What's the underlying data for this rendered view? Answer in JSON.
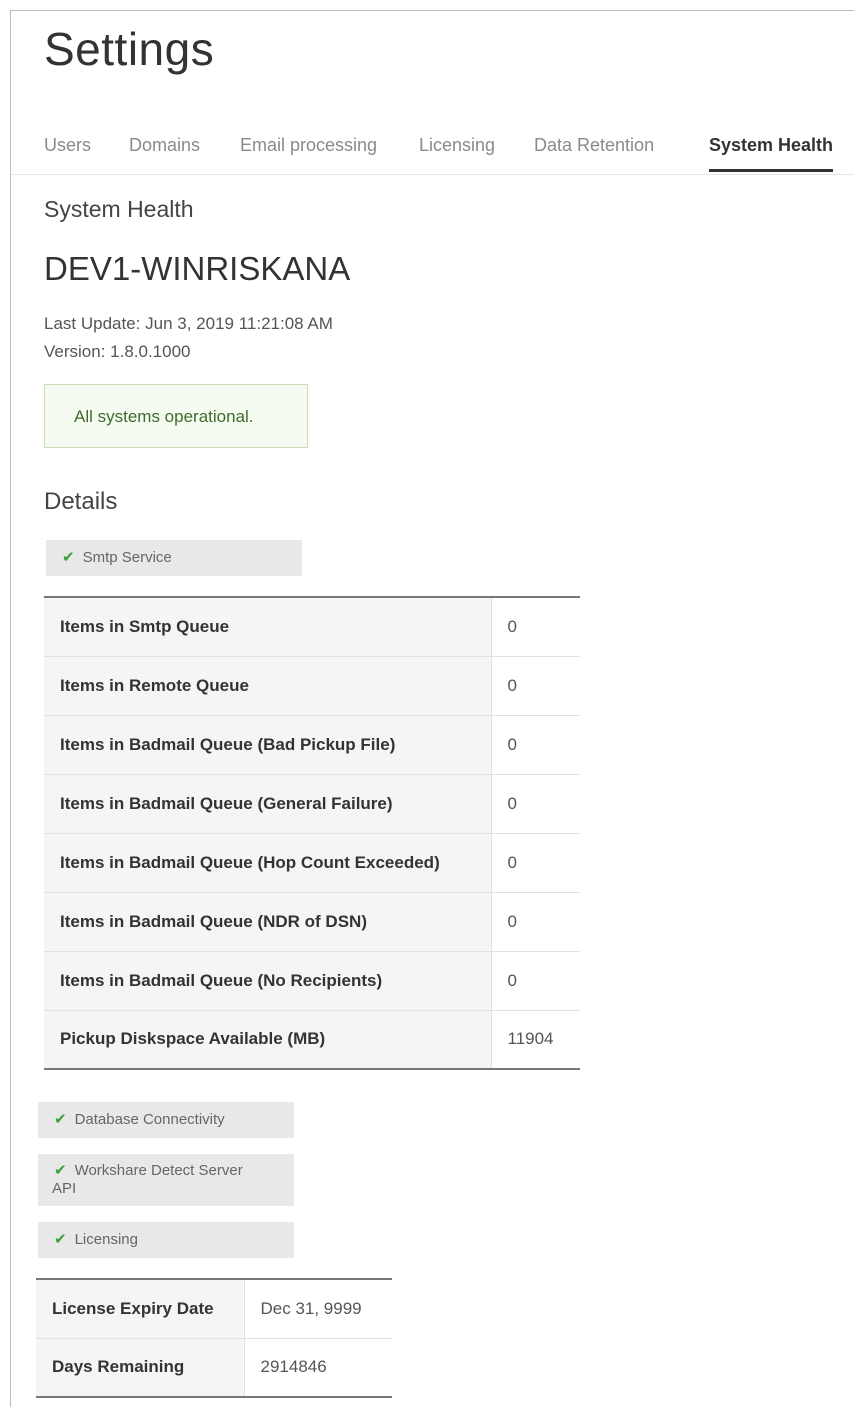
{
  "page": {
    "title": "Settings"
  },
  "tabs": [
    {
      "label": "Users",
      "active": false
    },
    {
      "label": "Domains",
      "active": false
    },
    {
      "label": "Email processing",
      "active": false
    },
    {
      "label": "Licensing",
      "active": false
    },
    {
      "label": "Data Retention",
      "active": false
    },
    {
      "label": "System Health",
      "active": true
    }
  ],
  "system_health": {
    "section_title": "System Health",
    "server_name": "DEV1-WINRISKANA",
    "last_update": "Last Update: Jun 3, 2019 11:21:08 AM",
    "version": "Version: 1.8.0.1000",
    "status_message": "All systems operational."
  },
  "details": {
    "title": "Details",
    "smtp_service": {
      "label": "Smtp Service",
      "rows": [
        {
          "label": "Items in Smtp Queue",
          "value": "0"
        },
        {
          "label": "Items in Remote Queue",
          "value": "0"
        },
        {
          "label": "Items in Badmail Queue (Bad Pickup File)",
          "value": "0"
        },
        {
          "label": "Items in Badmail Queue (General Failure)",
          "value": "0"
        },
        {
          "label": "Items in Badmail Queue (Hop Count Exceeded)",
          "value": "0"
        },
        {
          "label": "Items in Badmail Queue (NDR of DSN)",
          "value": "0"
        },
        {
          "label": "Items in Badmail Queue (No Recipients)",
          "value": "0"
        },
        {
          "label": "Pickup Diskspace Available (MB)",
          "value": "11904"
        }
      ]
    },
    "database_connectivity": {
      "label": "Database Connectivity"
    },
    "workshare_api": {
      "label_line1": "Workshare Detect Server",
      "label_line2": "API"
    },
    "licensing": {
      "label": "Licensing",
      "rows": [
        {
          "label": "License Expiry Date",
          "value": "Dec 31, 9999"
        },
        {
          "label": "Days Remaining",
          "value": "2914846"
        }
      ]
    }
  },
  "colors": {
    "check": "#3aa03a",
    "status_text": "#3f6b2c",
    "status_border": "#c9dcb9"
  }
}
